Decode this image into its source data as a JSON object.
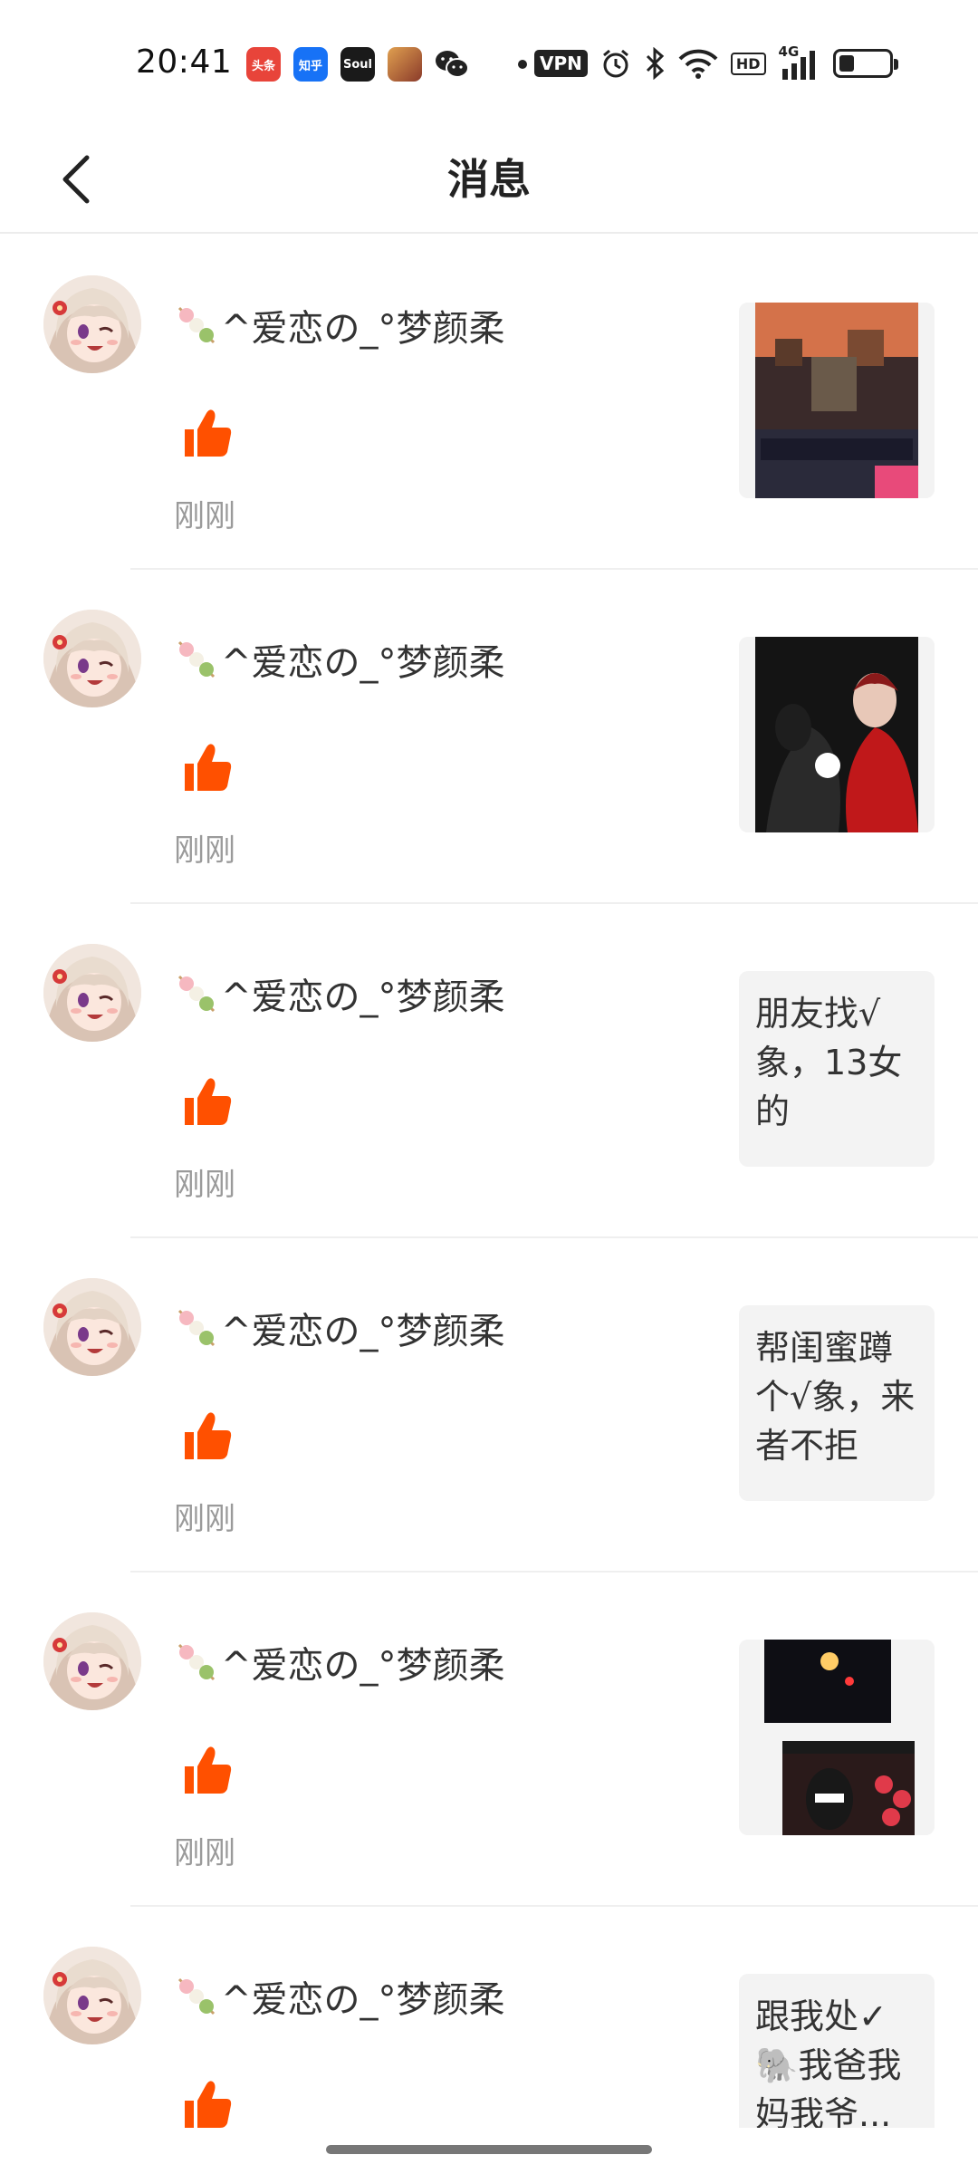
{
  "status_bar": {
    "time": "20:41",
    "apps": [
      {
        "name": "toutiao",
        "label": "头条",
        "color": "#e8443a"
      },
      {
        "name": "zhihu",
        "label": "知乎",
        "color": "#1772f6"
      },
      {
        "name": "soul",
        "label": "Soul",
        "color": "#1a1a1a"
      },
      {
        "name": "game",
        "label": "",
        "color": "#c07a3a"
      },
      {
        "name": "wechat",
        "label": "",
        "color": "#222222"
      }
    ],
    "vpn_label": "VPN",
    "hd_label": "HD",
    "network_label": "4G"
  },
  "header": {
    "title": "消息"
  },
  "accent_color": "#ff5000",
  "messages": [
    {
      "user": "^爱恋の_°梦颜柔",
      "time": "刚刚",
      "preview_type": "image",
      "preview_text": ""
    },
    {
      "user": "^爱恋の_°梦颜柔",
      "time": "刚刚",
      "preview_type": "image",
      "preview_text": ""
    },
    {
      "user": "^爱恋の_°梦颜柔",
      "time": "刚刚",
      "preview_type": "text",
      "preview_text": "朋友找√象，13女的"
    },
    {
      "user": "^爱恋の_°梦颜柔",
      "time": "刚刚",
      "preview_type": "text",
      "preview_text": "帮闺蜜蹲个√象，来者不拒"
    },
    {
      "user": "^爱恋の_°梦颜柔",
      "time": "刚刚",
      "preview_type": "image",
      "preview_text": ""
    },
    {
      "user": "^爱恋の_°梦颜柔",
      "time": "",
      "preview_type": "text",
      "preview_text": "跟我处✓🐘我爸我妈我爷..."
    }
  ]
}
